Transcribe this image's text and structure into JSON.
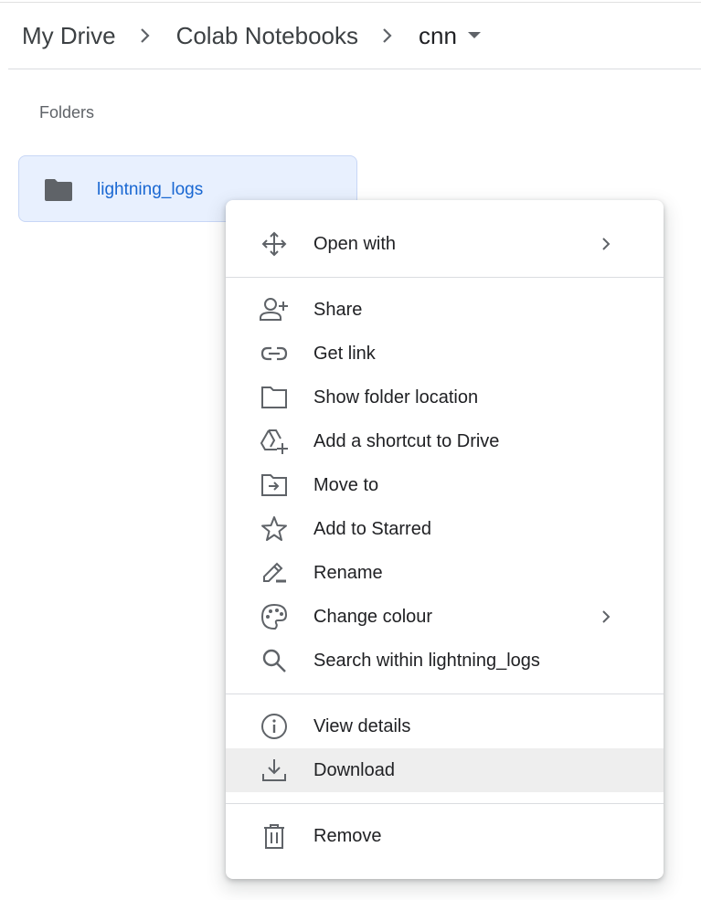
{
  "breadcrumb": {
    "items": [
      "My Drive",
      "Colab Notebooks",
      "cnn"
    ],
    "separator_icon": "chevron-right-icon",
    "dropdown_icon": "caret-down-icon"
  },
  "folders_section": {
    "label": "Folders",
    "items": [
      {
        "name": "lightning_logs",
        "icon": "folder-icon",
        "selected": true
      }
    ]
  },
  "context_menu": {
    "groups": [
      [
        {
          "label": "Open with",
          "icon": "move-arrows-icon",
          "submenu": true
        }
      ],
      [
        {
          "label": "Share",
          "icon": "person-add-icon"
        },
        {
          "label": "Get link",
          "icon": "link-icon"
        },
        {
          "label": "Show folder location",
          "icon": "folder-outline-icon"
        },
        {
          "label": "Add a shortcut to Drive",
          "icon": "drive-shortcut-icon"
        },
        {
          "label": "Move to",
          "icon": "move-to-folder-icon"
        },
        {
          "label": "Add to Starred",
          "icon": "star-outline-icon"
        },
        {
          "label": "Rename",
          "icon": "pencil-icon"
        },
        {
          "label": "Change colour",
          "icon": "palette-icon",
          "submenu": true
        },
        {
          "label": "Search within lightning_logs",
          "icon": "search-icon"
        }
      ],
      [
        {
          "label": "View details",
          "icon": "info-icon"
        },
        {
          "label": "Download",
          "icon": "download-icon",
          "highlighted": true
        }
      ],
      [
        {
          "label": "Remove",
          "icon": "trash-icon"
        }
      ]
    ]
  },
  "colors": {
    "selected_folder_bg": "#e8f0fe",
    "selected_folder_text": "#1967d2",
    "icon_gray": "#5f6368",
    "hover_bg": "#eeeeee"
  }
}
